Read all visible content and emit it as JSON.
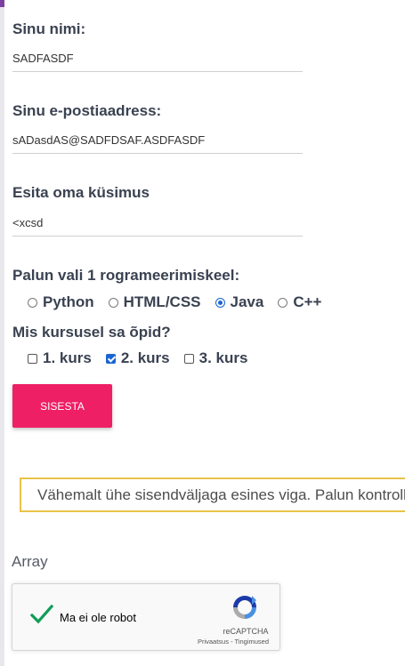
{
  "form": {
    "name": {
      "label": "Sinu nimi:",
      "value": "SADFASDF"
    },
    "email": {
      "label": "Sinu e-postiaadress:",
      "value": "sADasdAS@SADFDSAF.ASDFASDF"
    },
    "question": {
      "label": "Esita oma küsimus",
      "value": "<xcsd"
    },
    "language": {
      "title": "Palun vali 1 rogrameerimiskeel:",
      "options": [
        {
          "label": "Python",
          "checked": false
        },
        {
          "label": "HTML/CSS",
          "checked": false
        },
        {
          "label": "Java",
          "checked": true
        },
        {
          "label": "C++",
          "checked": false
        }
      ]
    },
    "course": {
      "title": "Mis kursusel sa õpid?",
      "options": [
        {
          "label": "1. kurs",
          "checked": false
        },
        {
          "label": "2. kurs",
          "checked": true
        },
        {
          "label": "3. kurs",
          "checked": false
        }
      ]
    },
    "submit_label": "SISESTA"
  },
  "warning": {
    "text": "Vähemalt ühe sisendväljaga esines viga. Palun kontrolli"
  },
  "debug_output": "Array",
  "recaptcha": {
    "label": "Ma ei ole robot",
    "brand": "reCAPTCHA",
    "privacy": "Privaatsus",
    "separator": " - ",
    "terms": "Tingimused",
    "checked": true
  },
  "colors": {
    "accent_pink": "#ee1f65",
    "warning_border": "#e9c24a",
    "check_blue": "#1a66d2",
    "check_green": "#0f9d58"
  }
}
